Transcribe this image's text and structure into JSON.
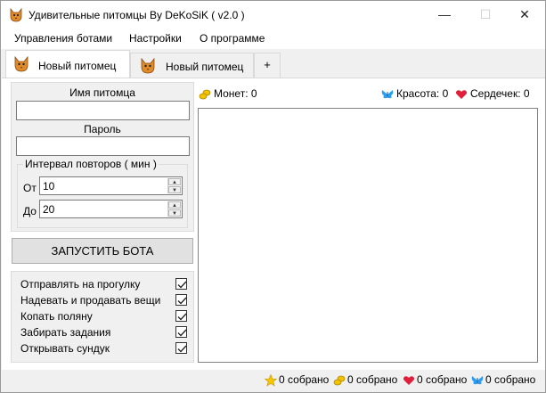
{
  "window": {
    "title": "Удивительные питомцы By DeKoSiK ( v2.0 )",
    "controls": {
      "minimize": "—",
      "maximize": "☐",
      "close": "✕"
    }
  },
  "menu": {
    "items": [
      "Управления ботами",
      "Настройки",
      "О программе"
    ]
  },
  "tabs": {
    "items": [
      {
        "label": "Новый питомец",
        "icon": "cat-icon",
        "active": true
      },
      {
        "label": "Новый питомец",
        "icon": "cat-icon",
        "active": false
      }
    ],
    "add_label": "+"
  },
  "login": {
    "name_label": "Имя питомца",
    "name_value": "",
    "password_label": "Пароль",
    "password_value": ""
  },
  "interval": {
    "legend": "Интервал повторов ( мин )",
    "from_label": "От",
    "from_value": "10",
    "to_label": "До",
    "to_value": "20"
  },
  "start_button": "ЗАПУСТИТЬ БОТА",
  "options": [
    {
      "label": "Отправлять на прогулку",
      "checked": true
    },
    {
      "label": "Надевать и продавать вещи",
      "checked": true
    },
    {
      "label": "Копать поляну",
      "checked": true
    },
    {
      "label": "Забирать задания",
      "checked": true
    },
    {
      "label": "Открывать сундук",
      "checked": true
    }
  ],
  "stats": {
    "coins": "Монет: 0",
    "beauty": "Красота: 0",
    "hearts": "Сердечек: 0"
  },
  "status_bar": {
    "stars": "0 собрано",
    "coins": "0 собрано",
    "hearts": "0 собрано",
    "butterflies": "0 собрано"
  },
  "colors": {
    "coin": "#f2c300",
    "heart": "#e0203a",
    "butterfly": "#2a9df4",
    "star": "#f7c600"
  }
}
